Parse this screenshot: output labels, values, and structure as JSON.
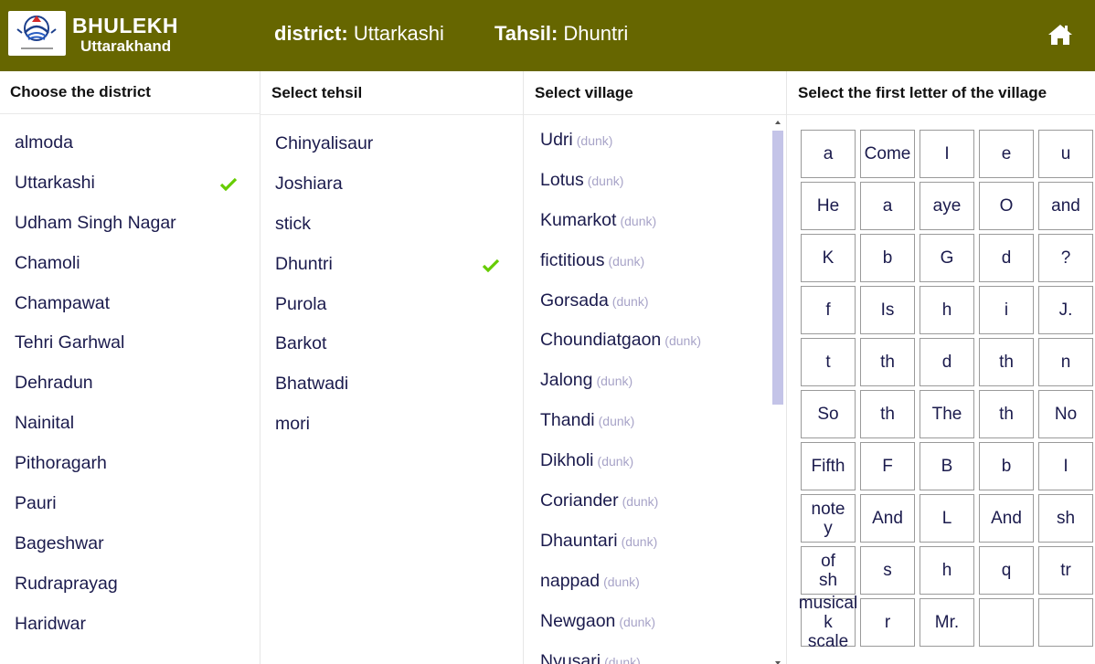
{
  "header": {
    "brand_title": "BHULEKH",
    "brand_subtitle": "Uttarakhand",
    "district_label": "district:",
    "district_value": "Uttarkashi",
    "tahsil_label": "Tahsil:",
    "tahsil_value": "Dhuntri",
    "home_icon": "home-icon",
    "background_color": "#666600"
  },
  "district_column": {
    "heading": "Choose the district",
    "items": [
      "almoda",
      "Uttarkashi",
      "Udham Singh Nagar",
      "Chamoli",
      "Champawat",
      "Tehri Garhwal",
      "Dehradun",
      "Nainital",
      "Pithoragarh",
      "Pauri",
      "Bageshwar",
      "Rudraprayag",
      "Haridwar"
    ],
    "selected": "Uttarkashi"
  },
  "tehsil_column": {
    "heading": "Select tehsil",
    "items": [
      "Chinyalisaur",
      "Joshiara",
      "stick",
      "Dhuntri",
      "Purola",
      "Barkot",
      "Bhatwadi",
      "mori"
    ],
    "selected": "Dhuntri"
  },
  "village_column": {
    "heading": "Select village",
    "tag": "(dunk)",
    "items": [
      "Udri",
      "Lotus",
      "Kumarkot",
      "fictitious",
      "Gorsada",
      "Choundiatgaon",
      "Jalong",
      "Thandi",
      "Dikholi",
      "Coriander",
      "Dhauntari",
      "nappad",
      "Newgaon",
      "Nyusari"
    ]
  },
  "letter_column": {
    "heading": "Select the first letter of the village",
    "letters": [
      "a",
      "Come",
      "I",
      "e",
      "u",
      "He",
      "a",
      "aye",
      "O",
      "and",
      "K",
      "b",
      "G",
      "d",
      "?",
      "f",
      "Is",
      "h",
      "i",
      "J.",
      "t",
      "th",
      "d",
      "th",
      "n",
      "So",
      "th",
      "The",
      "th",
      "No",
      "Fifth",
      "F",
      "B",
      "b",
      "I",
      "note\ny",
      "And",
      "L",
      "And",
      "sh",
      "of\nsh",
      "s",
      "h",
      "q",
      "tr",
      "musical\nk\nscale",
      "r",
      "Mr.",
      "",
      ""
    ]
  },
  "colors": {
    "check": "#66cc00",
    "list_text": "#1b1b4d",
    "tag_text": "#a8a4c8",
    "scrollbar_thumb": "#c4c4e8"
  }
}
